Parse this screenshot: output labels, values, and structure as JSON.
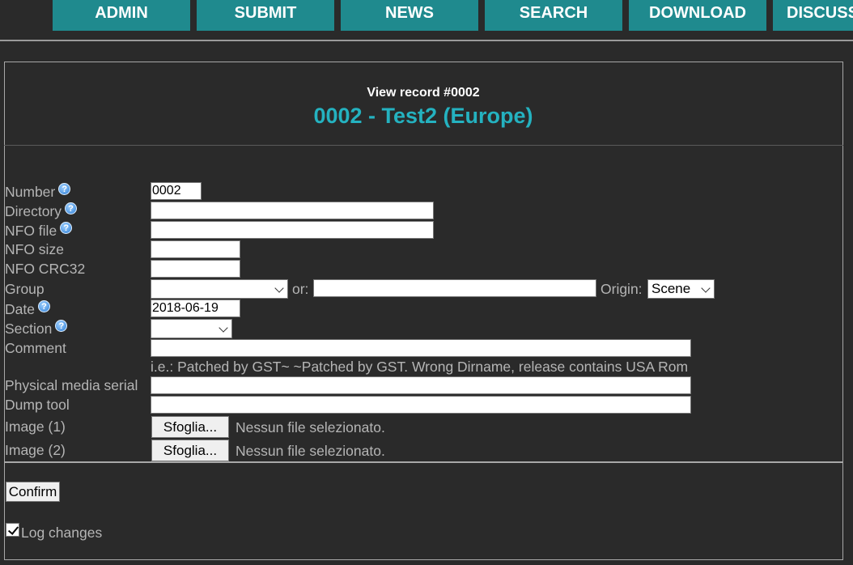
{
  "nav": {
    "items": [
      "ADMIN",
      "SUBMIT",
      "NEWS",
      "SEARCH",
      "DOWNLOAD",
      "DISCUSS"
    ]
  },
  "record": {
    "view_label": "View record #0002",
    "title": "0002 - Test2 (Europe)"
  },
  "form": {
    "number": {
      "label": "Number",
      "value": "0002"
    },
    "directory": {
      "label": "Directory",
      "value": ""
    },
    "nfo_file": {
      "label": "NFO file",
      "value": ""
    },
    "nfo_size": {
      "label": "NFO size",
      "value": ""
    },
    "nfo_crc32": {
      "label": "NFO CRC32",
      "value": ""
    },
    "group": {
      "label": "Group",
      "selected": "",
      "or_label": "or:",
      "other_value": ""
    },
    "origin": {
      "label": "Origin:",
      "selected": "Scene"
    },
    "date": {
      "label": "Date",
      "value": "2018-06-19"
    },
    "section": {
      "label": "Section",
      "selected": ""
    },
    "comment": {
      "label": "Comment",
      "value": "",
      "hint": "i.e.: Patched by GST~ ~Patched by GST. Wrong Dirname, release contains USA Rom"
    },
    "physical_media_serial": {
      "label": "Physical media serial",
      "value": ""
    },
    "dump_tool": {
      "label": "Dump tool",
      "value": ""
    },
    "image1": {
      "label": "Image (1)",
      "button": "Sfoglia...",
      "status": "Nessun file selezionato."
    },
    "image2": {
      "label": "Image (2)",
      "button": "Sfoglia...",
      "status": "Nessun file selezionato."
    },
    "confirm": "Confirm",
    "log_changes": {
      "label": "Log changes",
      "checked": true
    }
  }
}
